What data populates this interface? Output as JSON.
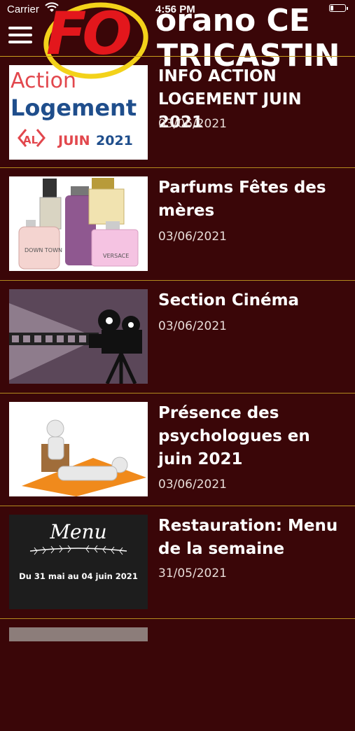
{
  "status": {
    "carrier": "Carrier",
    "time": "4:56 PM"
  },
  "header": {
    "logo_text": "FO",
    "brand_line1": "orano CE",
    "brand_line2": "TRICASTIN"
  },
  "items": [
    {
      "title": "INFO ACTION LOGEMENT JUIN 2021",
      "date": "03/06/2021",
      "thumb": {
        "line1": "Action",
        "line2": "Logement",
        "badge": "AL",
        "month": "JUIN",
        "year": "2021"
      }
    },
    {
      "title": "Parfums Fêtes des mères",
      "date": "03/06/2021",
      "thumb": {
        "label1": "DOWN TOWN",
        "label2": "VERSACE"
      }
    },
    {
      "title": "Section Cinéma",
      "date": "03/06/2021"
    },
    {
      "title": "Présence des psychologues en juin 2021",
      "date": "03/06/2021"
    },
    {
      "title": "Restauration: Menu de la semaine",
      "date": "31/05/2021",
      "thumb": {
        "script": "Menu",
        "dates": "Du 31 mai au 04 juin 2021"
      }
    }
  ]
}
